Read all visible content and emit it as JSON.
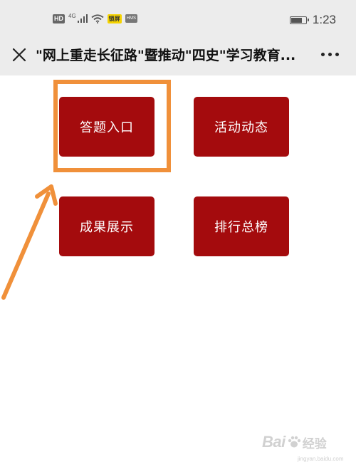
{
  "status_bar": {
    "hd_badge": "HD",
    "network_label": "4G",
    "app_badge": "锁屏",
    "hms_badge": "HMS",
    "battery_level": 0.8,
    "time": "1:23"
  },
  "nav": {
    "title": "\"网上重走长征路\"暨推动\"四史\"学习教育...",
    "close_icon": "close-icon",
    "more_icon": "more-icon"
  },
  "menu": {
    "items": [
      {
        "label": "答题入口"
      },
      {
        "label": "活动动态"
      },
      {
        "label": "成果展示"
      },
      {
        "label": "排行总榜"
      }
    ]
  },
  "annotation": {
    "highlight_color": "#f0903a"
  },
  "watermark": {
    "brand": "Bai",
    "brand_suffix": "经验",
    "url": "jingyan.baidu.com"
  },
  "colors": {
    "status_bg": "#ececec",
    "button_bg": "#a40b0d",
    "button_text": "#ffffff"
  }
}
